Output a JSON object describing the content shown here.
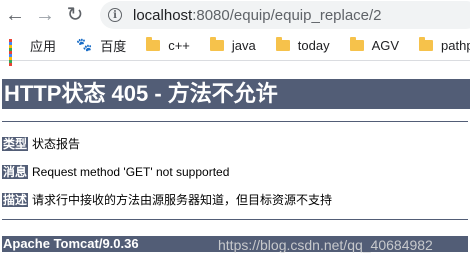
{
  "browser": {
    "url_host": "localhost",
    "url_rest": ":8080/equip/equip_replace/2",
    "bookmarks": [
      {
        "label": "应用",
        "icon": "apps-grid-icon"
      },
      {
        "label": "百度",
        "icon": "baidu-paw-icon"
      },
      {
        "label": "c++",
        "icon": "folder-icon"
      },
      {
        "label": "java",
        "icon": "folder-icon"
      },
      {
        "label": "today",
        "icon": "folder-icon"
      },
      {
        "label": "AGV",
        "icon": "folder-icon"
      },
      {
        "label": "pathpla",
        "icon": "folder-icon"
      }
    ]
  },
  "error_page": {
    "title": "HTTP状态 405 - 方法不允许",
    "type_label": "类型",
    "type_value": "状态报告",
    "message_label": "消息",
    "message_value": "Request method 'GET' not supported",
    "description_label": "描述",
    "description_value": "请求行中接收的方法由源服务器知道，但目标资源不支持",
    "server": "Apache Tomcat/9.0.36"
  },
  "watermark": "https://blog.csdn.net/qq_40684982",
  "colors": {
    "header_bg": "#525d76",
    "folder": "#f6c24b",
    "omnibox_bg": "#f1f3f4"
  }
}
